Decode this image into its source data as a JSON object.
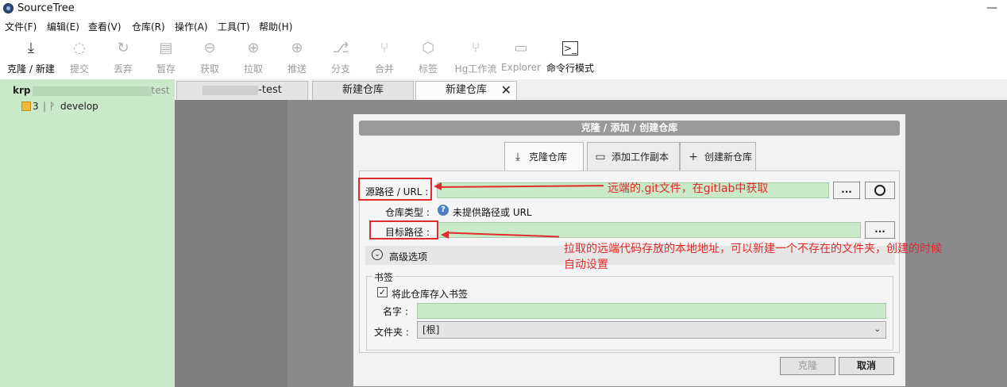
{
  "app": {
    "title": "SourceTree",
    "minimize_glyph": "—"
  },
  "menu": [
    {
      "label": "文件(F)"
    },
    {
      "label": "编辑(E)"
    },
    {
      "label": "查看(V)"
    },
    {
      "label": "仓库(R)"
    },
    {
      "label": "操作(A)"
    },
    {
      "label": "工具(T)"
    },
    {
      "label": "帮助(H)"
    }
  ],
  "toolbar": [
    {
      "label": "克隆 / 新建",
      "icon": "clone-icon",
      "glyph": "⤓",
      "enabled": true
    },
    {
      "label": "提交",
      "icon": "commit-icon",
      "glyph": "◌",
      "enabled": false
    },
    {
      "label": "丢弃",
      "icon": "discard-icon",
      "glyph": "↻",
      "enabled": false
    },
    {
      "label": "暂存",
      "icon": "stash-icon",
      "glyph": "▤",
      "enabled": false
    },
    {
      "label": "获取",
      "icon": "fetch-icon",
      "glyph": "⊖",
      "enabled": false
    },
    {
      "label": "拉取",
      "icon": "pull-icon",
      "glyph": "⊕",
      "enabled": false
    },
    {
      "label": "推送",
      "icon": "push-icon",
      "glyph": "⊕",
      "enabled": false
    },
    {
      "label": "分支",
      "icon": "branch-icon",
      "glyph": "⎇",
      "enabled": false
    },
    {
      "label": "合并",
      "icon": "merge-icon",
      "glyph": "⑂",
      "enabled": false
    },
    {
      "label": "标签",
      "icon": "tag-icon",
      "glyph": "⬡",
      "enabled": false
    },
    {
      "label": "Hg工作流",
      "icon": "hg-flow-icon",
      "glyph": "⑂",
      "enabled": false
    },
    {
      "label": "Explorer",
      "icon": "explorer-icon",
      "glyph": "▭",
      "enabled": false
    },
    {
      "label": "命令行模式",
      "icon": "terminal-icon",
      "glyph": ">_",
      "enabled": true
    }
  ],
  "sidebar": {
    "repo_path_prefix": "krp",
    "repo_path_suffix": "test",
    "branch_count": "3",
    "branch_separator": "|",
    "branch_name": "develop"
  },
  "tabs": [
    {
      "label": "-test"
    },
    {
      "label": "新建仓库"
    },
    {
      "label": "新建仓库",
      "close": "✕"
    }
  ],
  "dialog": {
    "title": "克隆 / 添加 / 创建仓库",
    "tabs": [
      {
        "label": "克隆仓库",
        "icon": "clone-icon",
        "glyph": "⤓"
      },
      {
        "label": "添加工作副本",
        "icon": "folder-icon",
        "glyph": "▭"
      },
      {
        "label": "创建新仓库",
        "icon": "plus-icon",
        "glyph": "+"
      }
    ],
    "source_label": "源路径 / URL :",
    "source_value": "",
    "browse_label": "...",
    "repo_type_label": "仓库类型 :",
    "repo_type_value": "未提供路径或 URL",
    "dest_label": "目标路径 :",
    "dest_value": "",
    "advanced_label": "高级选项",
    "bookmark_group": "书签",
    "bookmark_check_label": "将此仓库存入书签",
    "bookmark_checked": true,
    "name_label": "名字 :",
    "name_value": "",
    "folder_label": "文件夹 :",
    "folder_value": "[根]",
    "clone_button": "克隆",
    "cancel_button": "取消"
  },
  "annotations": {
    "source_note": "远端的.git文件，在gitlab中获取",
    "dest_note_line1": "拉取的远端代码存放的本地地址，可以新建一个不存在的文件夹，创建的时候",
    "dest_note_line2": "自动设置"
  },
  "colors": {
    "sidebar_bg": "#c9e9c9",
    "input_bg": "#c9e9c9",
    "annotation_red": "#e02b2b",
    "workspace_gray": "#7f7f7f"
  }
}
